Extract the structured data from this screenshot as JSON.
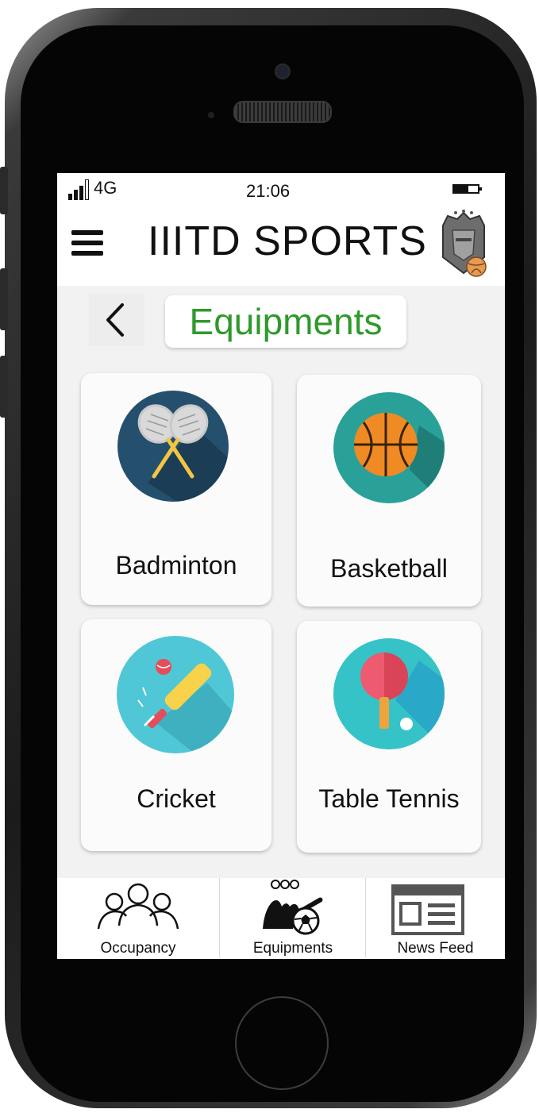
{
  "status_bar": {
    "network": "4G",
    "time": "21:06"
  },
  "app_bar": {
    "title": "IIITD SPORTS"
  },
  "header": {
    "title": "Equipments"
  },
  "cards": [
    {
      "label": "Badminton",
      "icon": "badminton-rackets-icon"
    },
    {
      "label": "Basketball",
      "icon": "basketball-icon"
    },
    {
      "label": "Cricket",
      "icon": "cricket-bat-ball-icon"
    },
    {
      "label": "Table Tennis",
      "icon": "table-tennis-paddle-icon"
    }
  ],
  "bottom_nav": [
    {
      "label": "Occupancy",
      "icon": "people-group-icon"
    },
    {
      "label": "Equipments",
      "icon": "sports-equipment-icon"
    },
    {
      "label": "News Feed",
      "icon": "newspaper-icon"
    }
  ],
  "colors": {
    "accent_green": "#2e9a2b",
    "badminton_bg": "#24506e",
    "basketball_bg": "#2aa198",
    "cricket_bg": "#4fc7d6",
    "tabletennis_bg": "#35c3c8"
  }
}
